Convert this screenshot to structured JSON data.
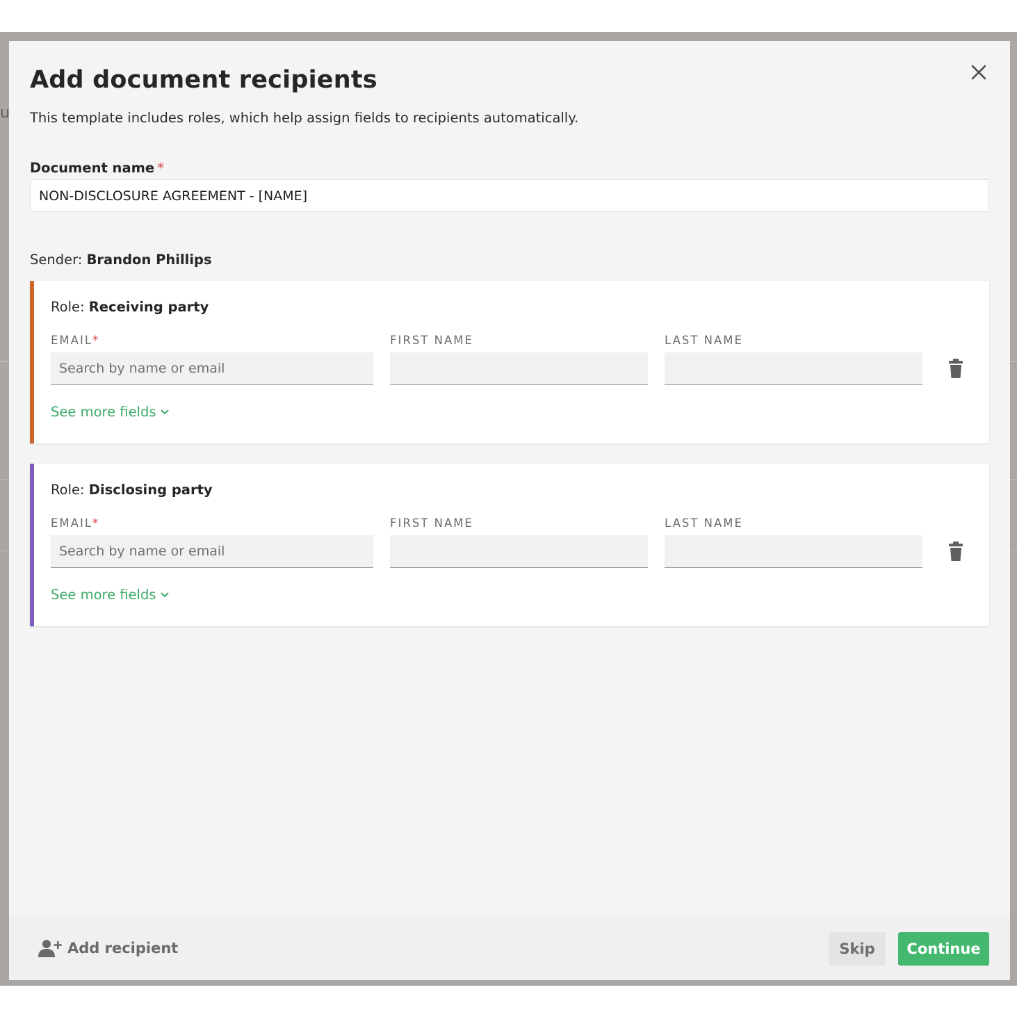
{
  "background": {
    "partial_text": "u"
  },
  "modal": {
    "title": "Add document recipients",
    "subtitle": "This template includes roles, which help assign fields to recipients automatically.",
    "close_icon": "close-icon",
    "document_name": {
      "label": "Document name",
      "required_marker": "*",
      "value": "NON-DISCLOSURE AGREEMENT - [NAME]"
    },
    "sender": {
      "label": "Sender:",
      "name": "Brandon Phillips"
    },
    "roles": [
      {
        "role_label": "Role:",
        "role_name": "Receiving party",
        "accent_color": "#c9672d",
        "email_label": "EMAIL",
        "email_required": "*",
        "email_placeholder": "Search by name or email",
        "email_value": "",
        "first_name_label": "FIRST NAME",
        "first_name_value": "",
        "last_name_label": "LAST NAME",
        "last_name_value": "",
        "see_more_label": "See more fields"
      },
      {
        "role_label": "Role:",
        "role_name": "Disclosing party",
        "accent_color": "#7f5cbf",
        "email_label": "EMAIL",
        "email_required": "*",
        "email_placeholder": "Search by name or email",
        "email_value": "",
        "first_name_label": "FIRST NAME",
        "first_name_value": "",
        "last_name_label": "LAST NAME",
        "last_name_value": "",
        "see_more_label": "See more fields"
      }
    ],
    "footer": {
      "add_recipient_label": "Add recipient",
      "skip_label": "Skip",
      "continue_label": "Continue"
    }
  },
  "colors": {
    "primary_green": "#45b86f",
    "link_green": "#3daa6a",
    "required_red": "#d9443f"
  }
}
